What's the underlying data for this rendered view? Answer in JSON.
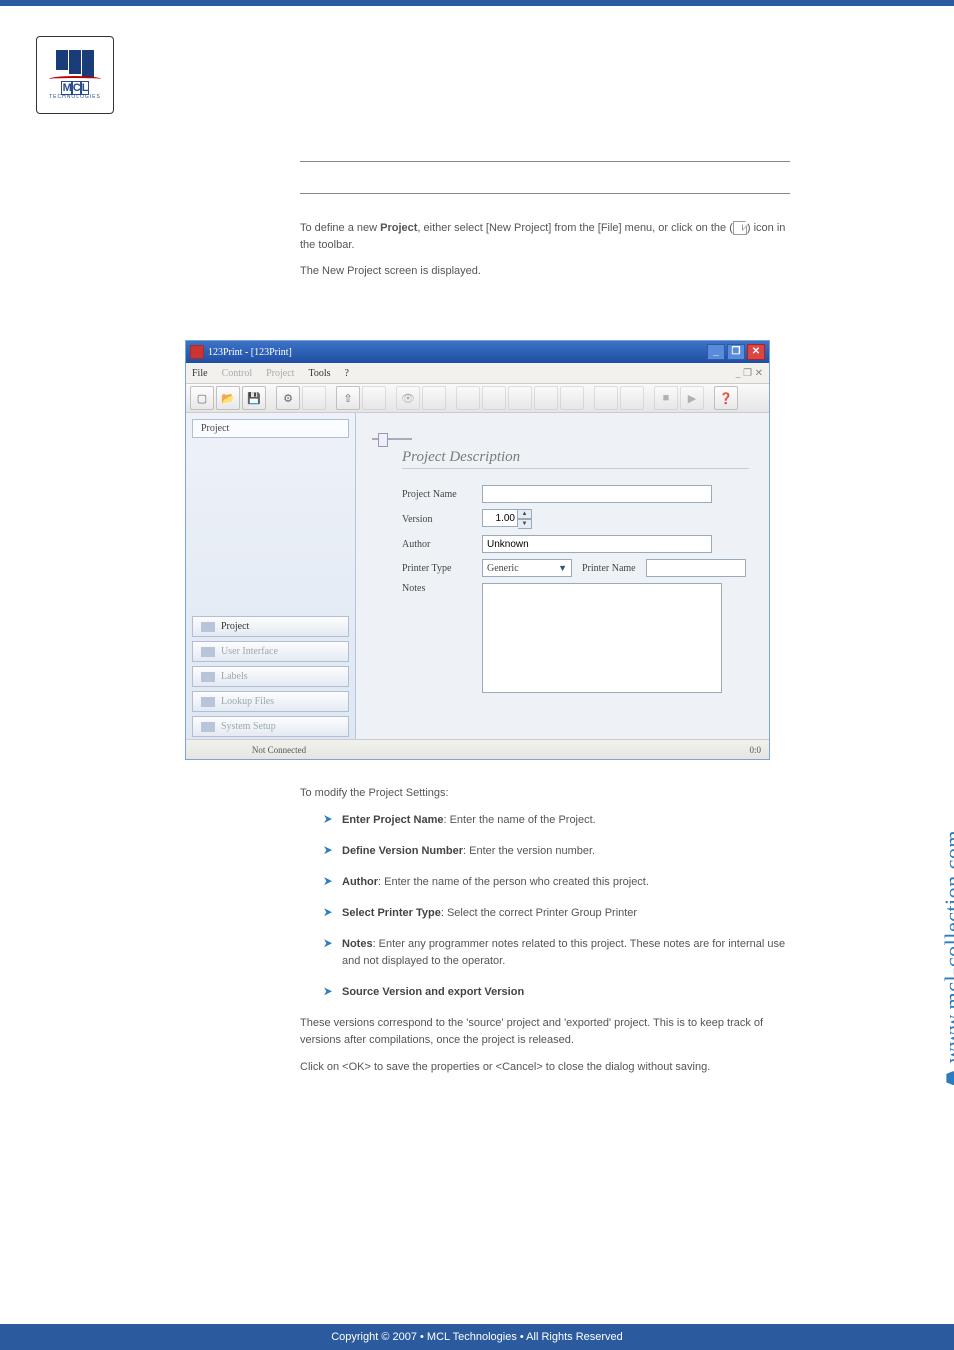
{
  "page": {
    "intro_line1_a": "To define a new ",
    "intro_line1_b": ", either select [New Project] from the [File] menu, or click on",
    "intro_line1_c": "the (",
    "intro_line1_d": ") icon in the toolbar.",
    "intro_line2": "The New Project screen is displayed.",
    "project_word": "Project",
    "below_lead": "To modify the Project Settings:",
    "closing1": "These versions correspond to the 'source' project and 'exported' project. This is to keep track of versions after compilations, once the project is released.",
    "closing2": "Click on <OK> to save the properties or <Cancel> to close the dialog without saving."
  },
  "bullets": [
    {
      "label": "Enter Project Name",
      "desc": ": Enter the name of the Project."
    },
    {
      "label": "Define Version Number",
      "desc": ": Enter the version number."
    },
    {
      "label": "Author",
      "desc": ": Enter the name of the person who created this project."
    },
    {
      "label": "Select Printer Type",
      "desc": ": Select the correct Printer Group Printer"
    },
    {
      "label": "Notes",
      "desc": ": Enter any programmer notes related to this project. These notes are for internal use and not displayed to the operator."
    },
    {
      "label": "Source Version and export Version",
      "desc": ""
    }
  ],
  "shot": {
    "title": "123Print - [123Print]",
    "menus": {
      "file": "File",
      "control": "Control",
      "project": "Project",
      "tools": "Tools",
      "help": "?"
    },
    "mdi": "_ ❐ ✕",
    "tree_head": "Project",
    "nav": {
      "project": "Project",
      "ui": "User Interface",
      "labels": "Labels",
      "lookup": "Lookup Files",
      "system": "System Setup"
    },
    "pane_title": "Project Description",
    "form": {
      "project_name_label": "Project Name",
      "version_label": "Version",
      "version_value": "1.00",
      "author_label": "Author",
      "author_value": "Unknown",
      "printer_type_label": "Printer Type",
      "printer_type_value": "Generic",
      "printer_name_label": "Printer Name",
      "notes_label": "Notes"
    },
    "status_left": "Not Connected",
    "status_right": "0:0"
  },
  "vurl": "www.mcl-collection.com",
  "footer": "Copyright © 2007 • MCL Technologies • All Rights Reserved"
}
